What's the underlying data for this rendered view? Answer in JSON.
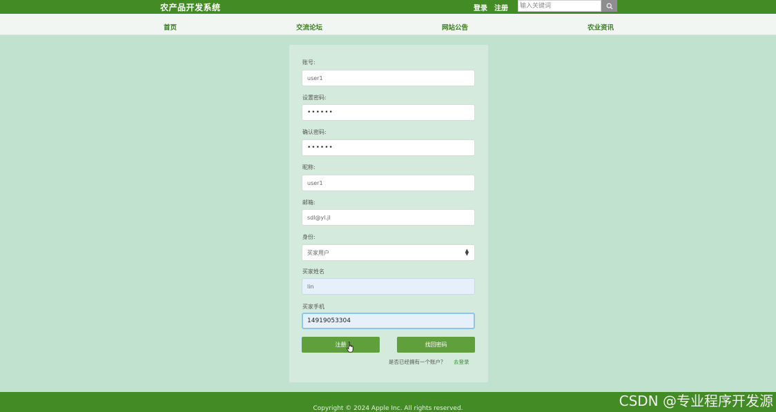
{
  "header": {
    "site_title": "农产品开发系统",
    "login_link": "登录",
    "register_link": "注册",
    "search_placeholder": "输入关键词"
  },
  "nav": {
    "items": [
      {
        "label": "首页"
      },
      {
        "label": "交流论坛"
      },
      {
        "label": "网站公告"
      },
      {
        "label": "农业资讯"
      }
    ]
  },
  "form": {
    "fields": [
      {
        "label": "账号:",
        "value": "user1"
      },
      {
        "label": "设置密码:",
        "value": "••••••"
      },
      {
        "label": "确认密码:",
        "value": "••••••"
      },
      {
        "label": "昵称:",
        "value": "user1"
      },
      {
        "label": "邮箱:",
        "value": "sdl@yl.jl"
      },
      {
        "label": "身份:",
        "value": "买家用户"
      },
      {
        "label": "买家姓名",
        "value": "lin"
      },
      {
        "label": "买家手机",
        "value": "14919053304"
      }
    ],
    "register_button": "注册",
    "recover_button": "找回密码",
    "have_account_text": "是否已经拥有一个账户？",
    "go_login_link": "去登录"
  },
  "footer": {
    "copyright": "Copyright © 2024 Apple Inc. All rights reserved."
  },
  "watermark": "CSDN @专业程序开发源",
  "colors": {
    "primary_green": "#438b24",
    "button_green": "#5fa03c",
    "page_background": "#c0e2cf",
    "card_background": "#d3eadc",
    "nav_background": "#f1f6f3"
  },
  "icons": {
    "search": "search-icon",
    "select_caret": "select-caret-icon",
    "cursor": "hand-cursor-icon"
  }
}
